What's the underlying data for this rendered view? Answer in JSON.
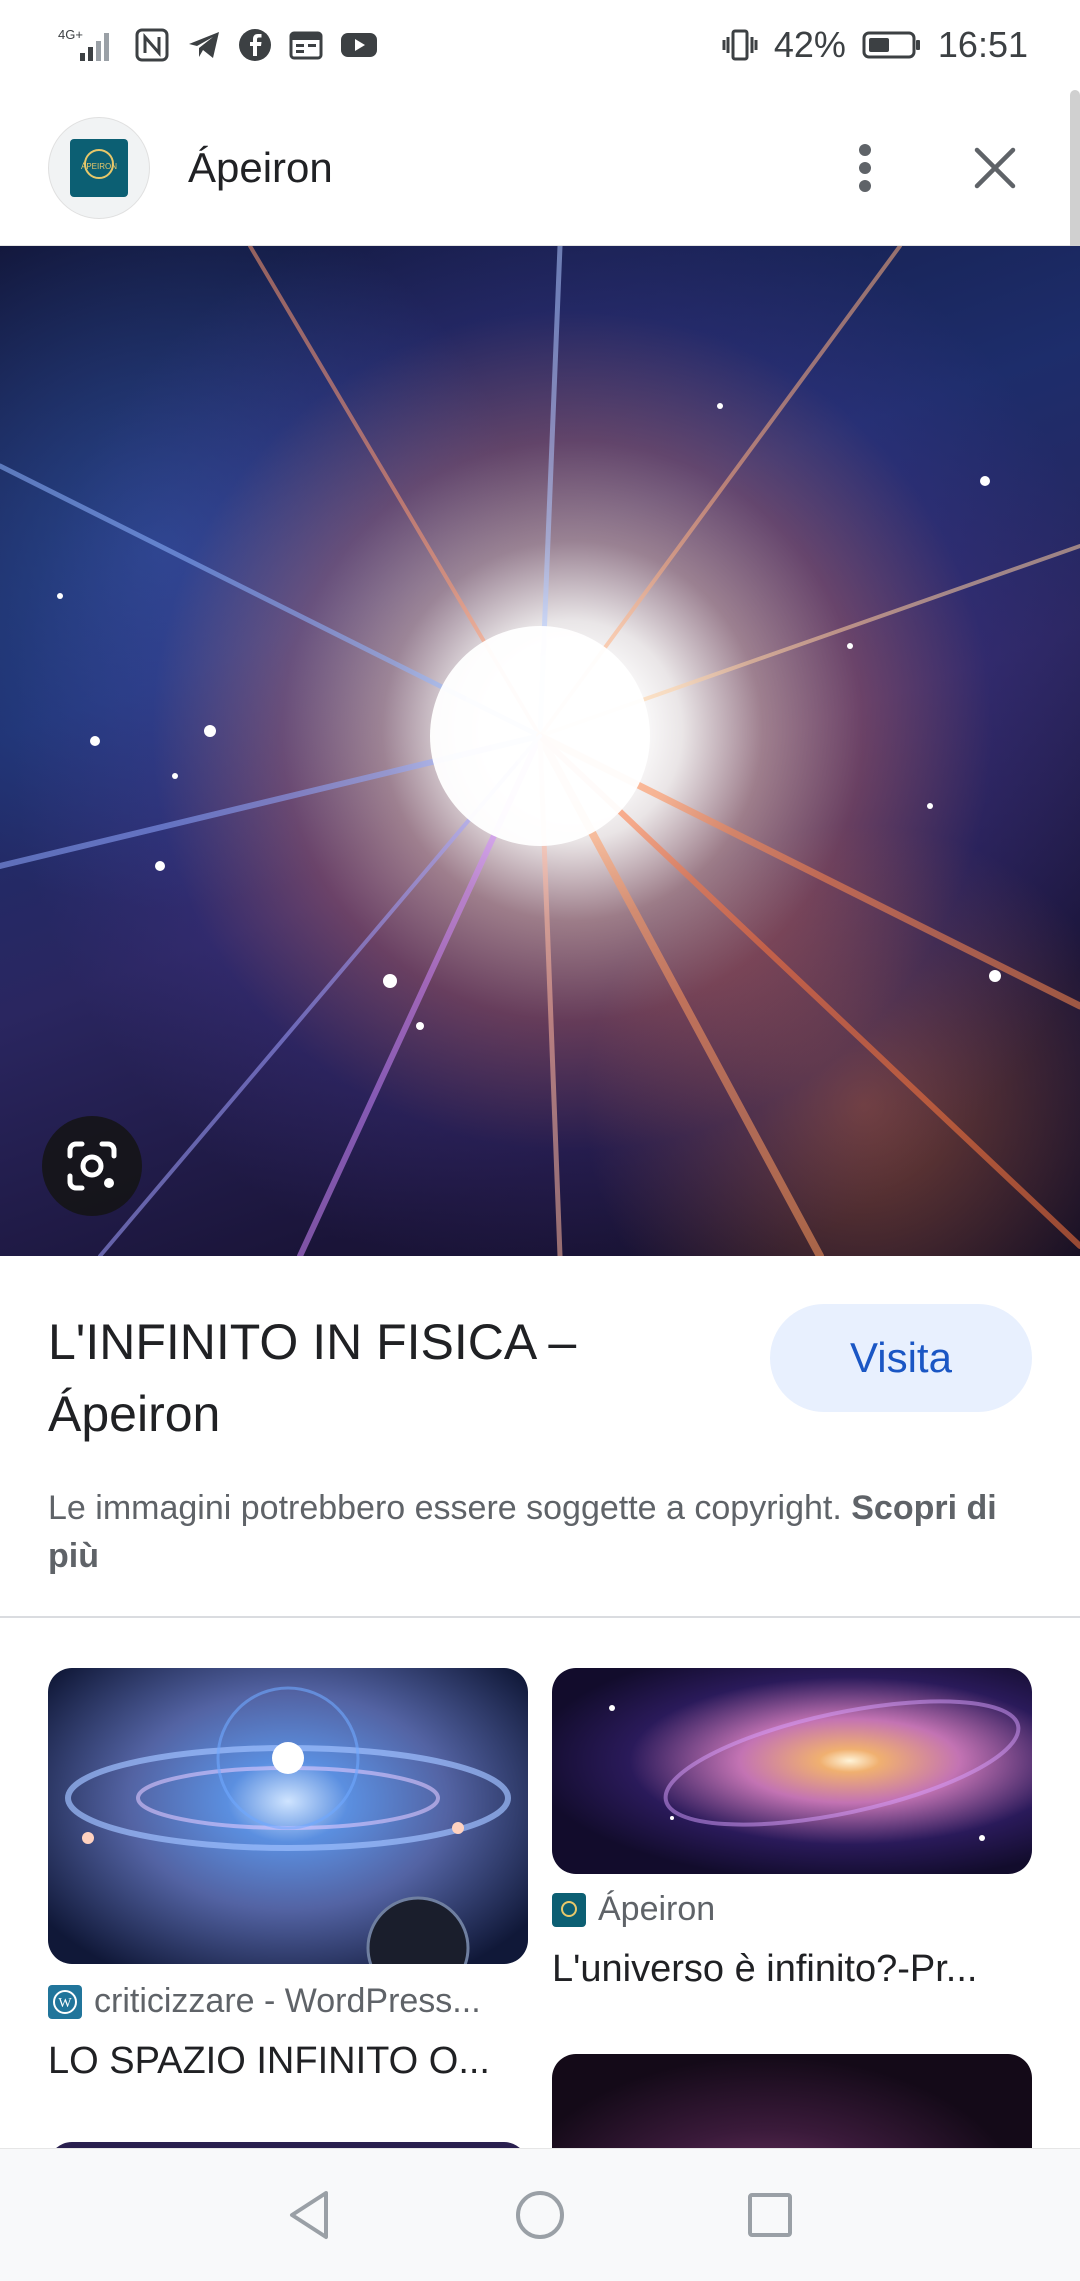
{
  "status_bar": {
    "network": "4G+",
    "battery": "42%",
    "time": "16:51"
  },
  "header": {
    "title": "Ápeiron",
    "favicon_text": "ÁPEIRON"
  },
  "result": {
    "title": "L'INFINITO IN FISICA – Ápeiron",
    "visit_label": "Visita",
    "copyright_text": "Le immagini potrebbero essere soggette a copyright.",
    "learn_more": "Scopri di più"
  },
  "related": [
    {
      "source": "criticizzare - WordPress...",
      "title": "LO SPAZIO INFINITO O...",
      "source_icon": "wordpress-icon"
    },
    {
      "source": "Ápeiron",
      "title": "L'universo è infinito?-Pr...",
      "source_icon": "apeiron-icon"
    }
  ],
  "colors": {
    "accent": "#1a56c4",
    "visit_bg": "#e8f0fe",
    "text_secondary": "#5f6368"
  }
}
